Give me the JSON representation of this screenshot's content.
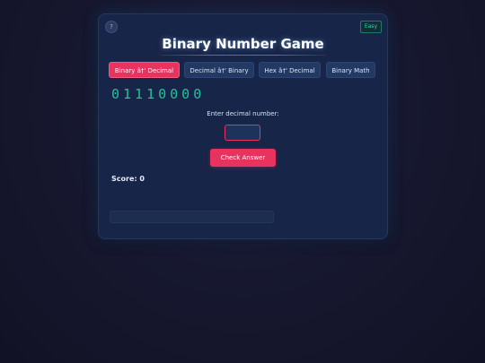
{
  "app": {
    "title": "Binary Number Game",
    "help_label": "?",
    "difficulty_label": "Easy"
  },
  "tabs": [
    {
      "label": "Binary â†' Decimal",
      "active": true
    },
    {
      "label": "Decimal â†' Binary",
      "active": false
    },
    {
      "label": "Hex â†' Decimal",
      "active": false
    },
    {
      "label": "Binary Math",
      "active": false
    }
  ],
  "question": {
    "binary_digits": "01110000",
    "prompt": "Enter decimal number:",
    "input_value": "",
    "input_placeholder": ""
  },
  "actions": {
    "check_label": "Check Answer"
  },
  "score": {
    "label": "Score: 0"
  },
  "feedback": {
    "message": ""
  },
  "colors": {
    "accent": "#e9335f",
    "binary": "#24c29a",
    "difficulty": "#3fd1aa",
    "card": "#172548",
    "background": "#14142a"
  }
}
